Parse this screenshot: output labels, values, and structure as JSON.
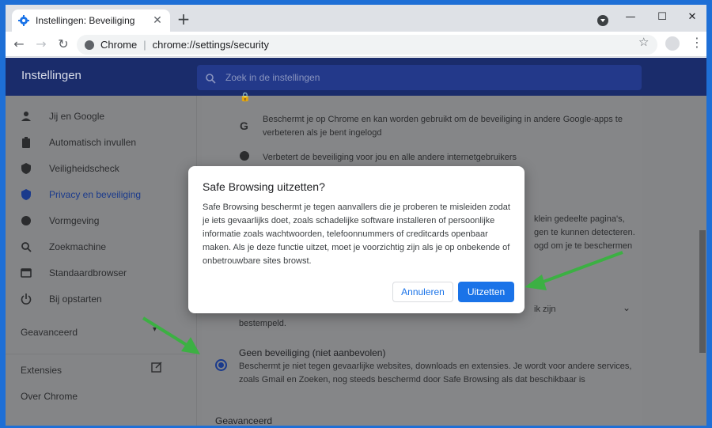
{
  "browser": {
    "tab_title": "Instellingen: Beveiliging",
    "site_label": "Chrome",
    "url": "chrome://settings/security"
  },
  "settings": {
    "header_title": "Instellingen",
    "search_placeholder": "Zoek in de instellingen",
    "sidebar": {
      "items": [
        {
          "label": "Jij en Google",
          "icon": "person-icon"
        },
        {
          "label": "Automatisch invullen",
          "icon": "clipboard-icon"
        },
        {
          "label": "Veiligheidscheck",
          "icon": "shield-check-icon"
        },
        {
          "label": "Privacy en beveiliging",
          "icon": "shield-icon"
        },
        {
          "label": "Vormgeving",
          "icon": "palette-icon"
        },
        {
          "label": "Zoekmachine",
          "icon": "search-icon"
        },
        {
          "label": "Standaardbrowser",
          "icon": "browser-icon"
        },
        {
          "label": "Bij opstarten",
          "icon": "power-icon"
        }
      ],
      "advanced": "Geavanceerd",
      "extensions": "Extensies",
      "about": "Over Chrome"
    },
    "content": {
      "google_text_1": "Beschermt je op Chrome en kan worden gebruikt om de beveiliging in andere Google-apps te",
      "google_text_2": "verbeteren als je bent ingelogd",
      "web_text": "Verbetert de beveiliging voor jou en alle andere internetgebruikers",
      "partial_1": "klein gedeelte pagina's,",
      "partial_2": "gen te kunnen detecteren.",
      "partial_3": "ogd om je te beschermen",
      "partial_4": "ik zijn",
      "partial_5": "bestempeld.",
      "option_title": "Geen beveiliging (niet aanbevolen)",
      "option_desc_1": "Beschermt je niet tegen gevaarlijke websites, downloads en extensies. Je wordt voor andere services,",
      "option_desc_2": "zoals Gmail en Zoeken, nog steeds beschermd door Safe Browsing als dat beschikbaar is",
      "advanced": "Geavanceerd"
    }
  },
  "dialog": {
    "title": "Safe Browsing uitzetten?",
    "body": "Safe Browsing beschermt je tegen aanvallers die je proberen te misleiden zodat je iets gevaarlijks doet, zoals schadelijke software installeren of persoonlijke informatie zoals wachtwoorden, telefoonnummers of creditcards openbaar maken. Als je deze functie uitzet, moet je voorzichtig zijn als je op onbekende of onbetrouwbare sites browst.",
    "cancel": "Annuleren",
    "confirm": "Uitzetten"
  },
  "colors": {
    "accent": "#1a73e8",
    "annotation_arrow": "#3cb043"
  }
}
